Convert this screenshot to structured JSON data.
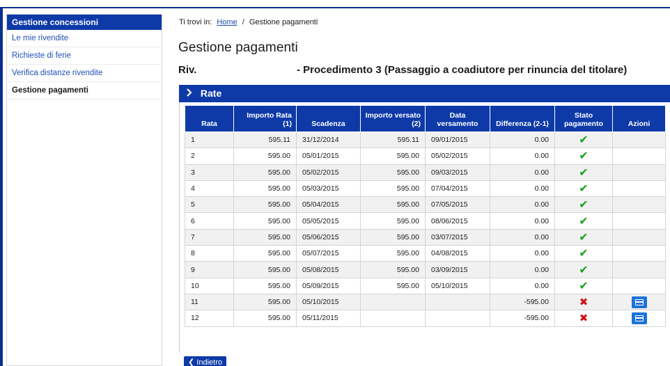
{
  "sidebar": {
    "header": "Gestione concessioni",
    "items": [
      {
        "label": "Le mie rivendite"
      },
      {
        "label": "Richieste di ferie"
      },
      {
        "label": "Verifica distanze rivendite"
      },
      {
        "label": "Gestione pagamenti"
      }
    ]
  },
  "breadcrumb": {
    "prefix": "Ti trovi in:",
    "home": "Home",
    "separator": "/",
    "current": "Gestione pagamenti"
  },
  "page": {
    "title": "Gestione pagamenti",
    "subtitle_prefix": "Riv.",
    "subtitle_desc": "- Procedimento 3 (Passaggio a coadiutore per rinuncia del titolare)"
  },
  "panel": {
    "title": "Rate",
    "columns": [
      "Rata",
      "Importo Rata (1)",
      "Scadenza",
      "Importo versato (2)",
      "Data versamento",
      "Differenza (2-1)",
      "Stato pagamento",
      "Azioni"
    ],
    "rows": [
      {
        "rata": "1",
        "importo": "595.11",
        "scadenza": "31/12/2014",
        "versato": "595.11",
        "data": "09/01/2015",
        "diff": "0.00",
        "stato": "paid",
        "azione": ""
      },
      {
        "rata": "2",
        "importo": "595.00",
        "scadenza": "05/01/2015",
        "versato": "595.00",
        "data": "05/02/2015",
        "diff": "0.00",
        "stato": "paid",
        "azione": ""
      },
      {
        "rata": "3",
        "importo": "595.00",
        "scadenza": "05/02/2015",
        "versato": "595.00",
        "data": "09/03/2015",
        "diff": "0.00",
        "stato": "paid",
        "azione": ""
      },
      {
        "rata": "4",
        "importo": "595.00",
        "scadenza": "05/03/2015",
        "versato": "595.00",
        "data": "07/04/2015",
        "diff": "0.00",
        "stato": "paid",
        "azione": ""
      },
      {
        "rata": "5",
        "importo": "595.00",
        "scadenza": "05/04/2015",
        "versato": "595.00",
        "data": "07/05/2015",
        "diff": "0.00",
        "stato": "paid",
        "azione": ""
      },
      {
        "rata": "6",
        "importo": "595.00",
        "scadenza": "05/05/2015",
        "versato": "595.00",
        "data": "08/06/2015",
        "diff": "0.00",
        "stato": "paid",
        "azione": ""
      },
      {
        "rata": "7",
        "importo": "595.00",
        "scadenza": "05/06/2015",
        "versato": "595.00",
        "data": "03/07/2015",
        "diff": "0.00",
        "stato": "paid",
        "azione": ""
      },
      {
        "rata": "8",
        "importo": "595.00",
        "scadenza": "05/07/2015",
        "versato": "595.00",
        "data": "04/08/2015",
        "diff": "0.00",
        "stato": "paid",
        "azione": ""
      },
      {
        "rata": "9",
        "importo": "595.00",
        "scadenza": "05/08/2015",
        "versato": "595.00",
        "data": "03/09/2015",
        "diff": "0.00",
        "stato": "paid",
        "azione": ""
      },
      {
        "rata": "10",
        "importo": "595.00",
        "scadenza": "05/09/2015",
        "versato": "595.00",
        "data": "05/10/2015",
        "diff": "0.00",
        "stato": "paid",
        "azione": ""
      },
      {
        "rata": "11",
        "importo": "595.00",
        "scadenza": "05/10/2015",
        "versato": "",
        "data": "",
        "diff": "-595.00",
        "stato": "unpaid",
        "azione": "pay-card-icon"
      },
      {
        "rata": "12",
        "importo": "595.00",
        "scadenza": "05/11/2015",
        "versato": "",
        "data": "",
        "diff": "-595.00",
        "stato": "unpaid",
        "azione": "pay-card-icon"
      }
    ]
  },
  "footer": {
    "back_label": "Indietro"
  },
  "colors": {
    "primary": "#0e3aa8",
    "link": "#1f4fb3",
    "ok": "#1aa01a",
    "ko": "#d21414",
    "action": "#1e73d8"
  }
}
